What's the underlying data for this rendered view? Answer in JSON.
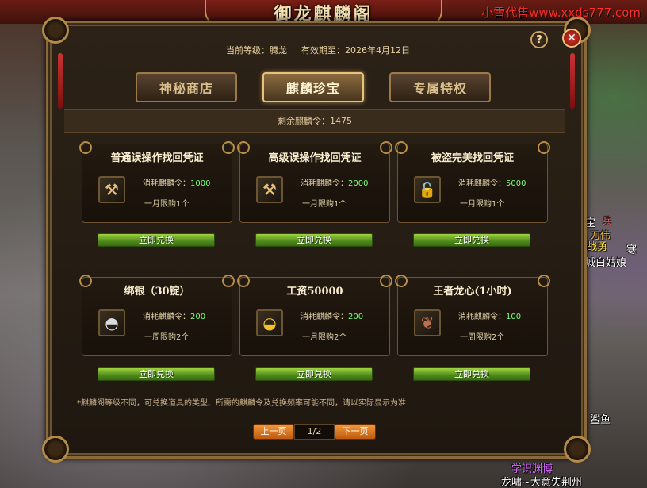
{
  "watermark": "小雪代售www.xxds777.com",
  "window_title": "御龙麒麟阁",
  "header": {
    "level_label": "当前等级：",
    "level_value": "腾龙",
    "expiry_label": "有效期至：",
    "expiry_value": "2026年4月12日",
    "help_symbol": "?",
    "close_symbol": "✕"
  },
  "tabs": [
    {
      "label": "神秘商店",
      "active": false
    },
    {
      "label": "麒麟珍宝",
      "active": true
    },
    {
      "label": "专属特权",
      "active": false
    }
  ],
  "remaining": {
    "label": "剩余麒麟令：",
    "value": "1475"
  },
  "items": [
    {
      "title": "普通误操作找回凭证",
      "cost_label": "消耗麒麟令：",
      "cost": "1000",
      "limit": "一月限购1个",
      "icon": "hammer-icon",
      "icon_glyph": "⚒",
      "button": "立即兑换"
    },
    {
      "title": "高级误操作找回凭证",
      "cost_label": "消耗麒麟令：",
      "cost": "2000",
      "limit": "一月限购1个",
      "icon": "hammer-icon",
      "icon_glyph": "⚒",
      "button": "立即兑换"
    },
    {
      "title": "被盗完美找回凭证",
      "cost_label": "消耗麒麟令：",
      "cost": "5000",
      "limit": "一月限购1个",
      "icon": "lock-icon",
      "icon_glyph": "🔓",
      "button": "立即兑换"
    },
    {
      "title": "绑银（30锭）",
      "cost_label": "消耗麒麟令：",
      "cost": "200",
      "limit": "一周限购2个",
      "icon": "silver-ingot-icon",
      "icon_glyph": "◓",
      "button": "立即兑换"
    },
    {
      "title": "工资50000",
      "cost_label": "消耗麒麟令：",
      "cost": "200",
      "limit": "一月限购2个",
      "icon": "gold-ingot-icon",
      "icon_glyph": "◒",
      "button": "立即兑换"
    },
    {
      "title": "王者龙心(1小时)",
      "cost_label": "消耗麒麟令：",
      "cost": "100",
      "limit": "一周限购2个",
      "icon": "dragon-heart-icon",
      "icon_glyph": "❦",
      "button": "立即兑换"
    }
  ],
  "note": "*麒麟阁等级不同，可兑换道具的类型、所需的麒麟令及兑换频率可能不同，请以实际显示为准",
  "pager": {
    "prev": "上一页",
    "current": "1/2",
    "next": "下一页"
  },
  "world": {
    "t1": "宝",
    "t_top": "兵",
    "t2": "刀伟",
    "t3": "战勇",
    "t4": "寒",
    "t5": "城白姑娘",
    "t6": "鲨鱼",
    "t7": "学识渊博",
    "t8": "龙啸~大意失荆州"
  },
  "colors": {
    "accent_gold": "#c69a4a",
    "cost_green": "#7dff7d",
    "button_green": "#6fa82a",
    "pager_orange": "#e07a20",
    "watermark_red": "#ff2d2d"
  }
}
